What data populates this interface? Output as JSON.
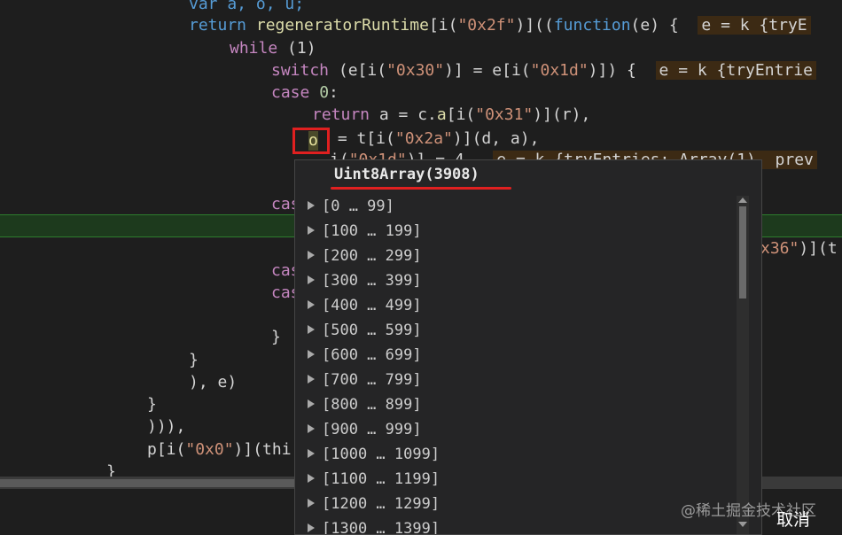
{
  "code": {
    "l1": "var a, o, u;",
    "l2_return": "return ",
    "l2_fn": "regeneratorRuntime",
    "l2_a": "[i(",
    "l2_str": "\"0x2f\"",
    "l2_b": ")]((",
    "l2_kw": "function",
    "l2_c": "(e) {",
    "l2_hint": "e = k {tryE",
    "l3_kw": "while",
    "l3_rest": " (1)",
    "l4_kw": "switch",
    "l4_a": " (e[i(",
    "l4_str1": "\"0x30\"",
    "l4_b": ")] = e[i(",
    "l4_str2": "\"0x1d\"",
    "l4_c": ")]) {",
    "l4_hint": "e = k {tryEntrie",
    "l5_kw": "case",
    "l5_num": "0",
    "l5_colon": ":",
    "l6_kw": "return",
    "l6_a": " a = c.",
    "l6_fn": "a",
    "l6_b": "[i(",
    "l6_str": "\"0x31\"",
    "l6_c": ")](r),",
    "l7_var": "o",
    "l7_a": " = t[i(",
    "l7_str": "\"0x2a\"",
    "l7_b": ")](d, a),",
    "l8_a": "i(",
    "l8_str": "\"0x1d\"",
    "l8_b": ")] = 4,",
    "l8_hint": "e = k {tryEntries: Array(1), prev",
    "l9_kw": "cas",
    "l10_str": "x36\"",
    "l10_rest": ")](t",
    "l11_kw": "cas",
    "l12_kw": "cas",
    "brace1": "}",
    "brace2": "}",
    "close1": "), e)",
    "brace3": "}",
    "close2": "))),",
    "l_p_a": "p[i(",
    "l_p_str": "\"0x0\"",
    "l_p_b": ")](thi",
    "brace4": "}"
  },
  "popup": {
    "title": "Uint8Array(3908)",
    "items": [
      "[0 … 99]",
      "[100 … 199]",
      "[200 … 299]",
      "[300 … 399]",
      "[400 … 499]",
      "[500 … 599]",
      "[600 … 699]",
      "[700 … 799]",
      "[800 … 899]",
      "[900 … 999]",
      "[1000 … 1099]",
      "[1100 … 1199]",
      "[1200 … 1299]",
      "[1300 … 1399]"
    ]
  },
  "watermark": "@稀土掘金技术社区",
  "cancel_label": "取消",
  "icons": {
    "expand": "triangle-right-icon"
  }
}
